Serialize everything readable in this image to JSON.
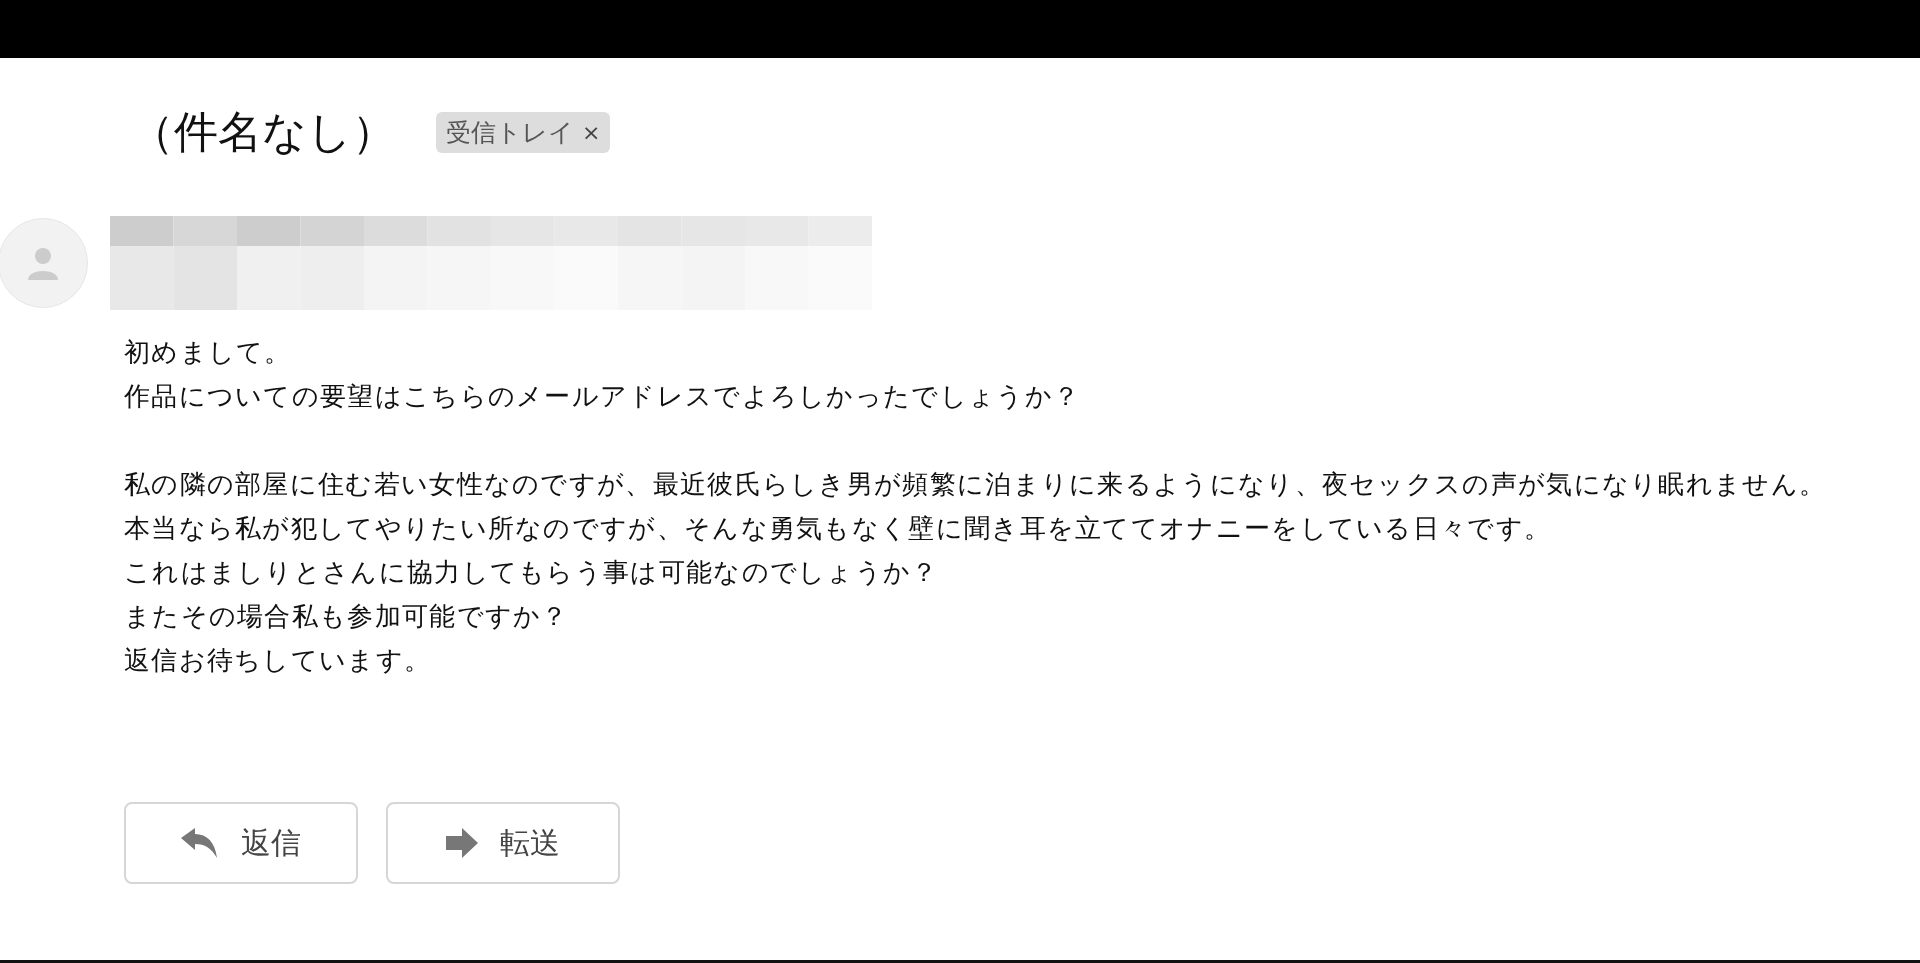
{
  "subject": "（件名なし）",
  "label": {
    "text": "受信トレイ",
    "close": "×"
  },
  "body": [
    [
      "初めまして。",
      "作品についての要望はこちらのメールアドレスでよろしかったでしょうか？"
    ],
    [
      "私の隣の部屋に住む若い女性なのですが、最近彼氏らしき男が頻繁に泊まりに来るようになり、夜セックスの声が気になり眠れません。",
      "本当なら私が犯してやりたい所なのですが、そんな勇気もなく壁に聞き耳を立ててオナニーをしている日々です。",
      "これはましりとさんに協力してもらう事は可能なのでしょうか？",
      "またその場合私も参加可能ですか？",
      "返信お待ちしています。"
    ]
  ],
  "actions": [
    {
      "kind": "reply",
      "label": "返信"
    },
    {
      "kind": "forward",
      "label": "転送"
    }
  ]
}
